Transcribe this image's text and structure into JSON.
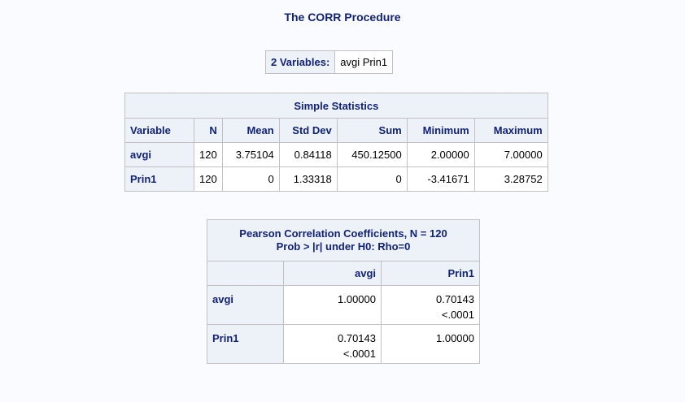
{
  "procedure_title": "The CORR Procedure",
  "variables": {
    "label": "2 Variables:",
    "value": "avgi Prin1"
  },
  "simple_statistics": {
    "caption": "Simple Statistics",
    "headers": [
      "Variable",
      "N",
      "Mean",
      "Std Dev",
      "Sum",
      "Minimum",
      "Maximum"
    ],
    "rows": [
      [
        "avgi",
        "120",
        "3.75104",
        "0.84118",
        "450.12500",
        "2.00000",
        "7.00000"
      ],
      [
        "Prin1",
        "120",
        "0",
        "1.33318",
        "0",
        "-3.41671",
        "3.28752"
      ]
    ]
  },
  "pearson": {
    "caption_line1": "Pearson Correlation Coefficients, N = 120",
    "caption_line2": "Prob > |r| under H0: Rho=0",
    "col_headers": [
      "avgi",
      "Prin1"
    ],
    "rows": [
      {
        "name": "avgi",
        "cells": [
          {
            "r": "1.00000",
            "p": ""
          },
          {
            "r": "0.70143",
            "p": "<.0001"
          }
        ]
      },
      {
        "name": "Prin1",
        "cells": [
          {
            "r": "0.70143",
            "p": "<.0001"
          },
          {
            "r": "1.00000",
            "p": ""
          }
        ]
      }
    ]
  }
}
